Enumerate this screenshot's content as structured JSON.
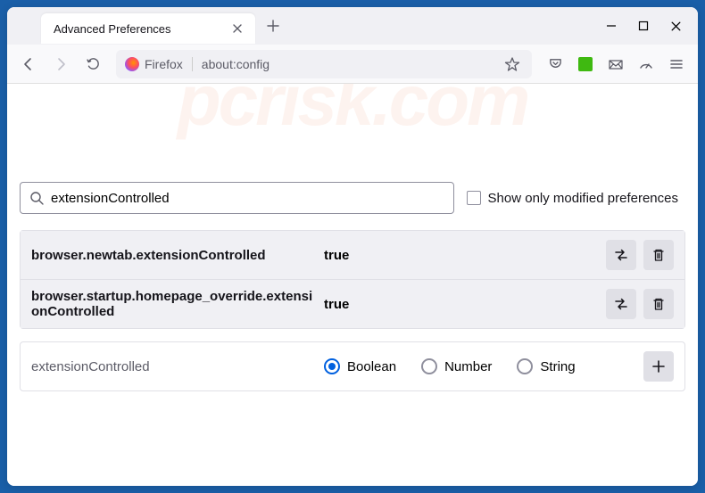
{
  "tab": {
    "title": "Advanced Preferences"
  },
  "url": {
    "identity": "Firefox",
    "path": "about:config"
  },
  "search": {
    "value": "extensionControlled",
    "show_modified_label": "Show only modified preferences"
  },
  "prefs": [
    {
      "name": "browser.newtab.extensionControlled",
      "value": "true"
    },
    {
      "name": "browser.startup.homepage_override.extensionControlled",
      "value": "true"
    }
  ],
  "newpref": {
    "name": "extensionControlled",
    "types": {
      "boolean": "Boolean",
      "number": "Number",
      "string": "String"
    }
  },
  "watermark": "pcrisk.com"
}
